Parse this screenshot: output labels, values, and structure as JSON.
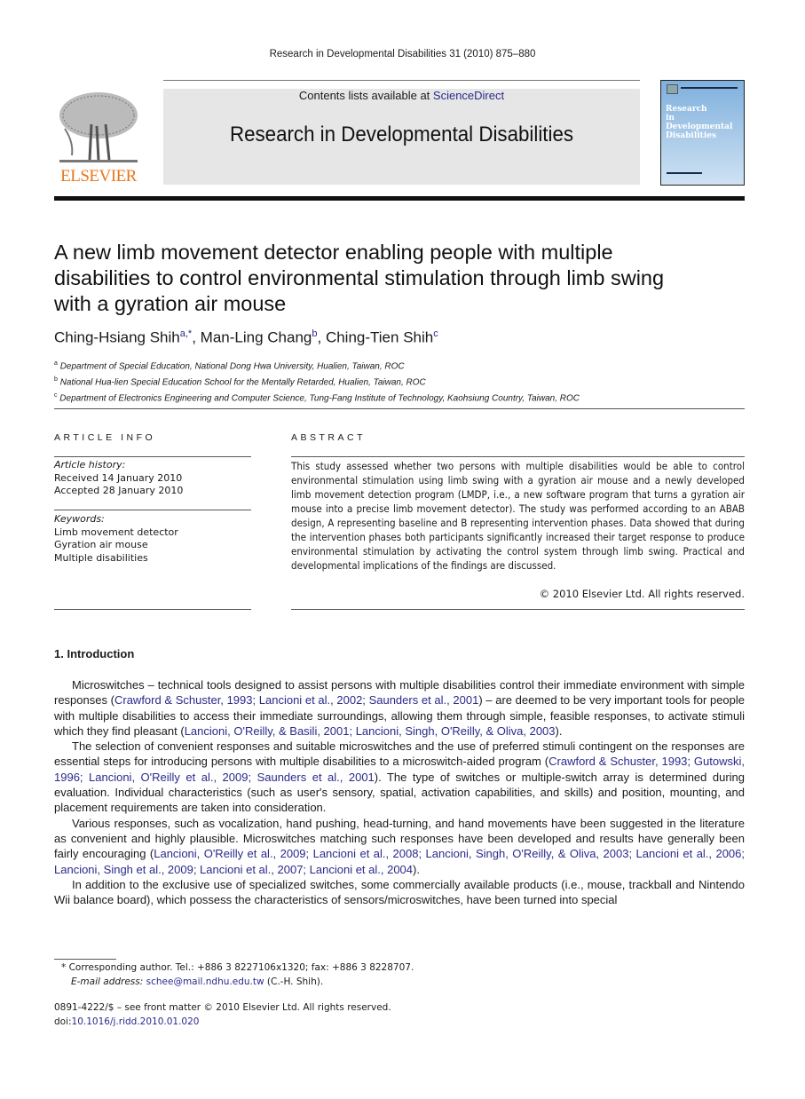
{
  "header": {
    "journal_reference": "Research in Developmental Disabilities 31 (2010) 875–880",
    "contents_prefix": "Contents lists available at ",
    "contents_link": "ScienceDirect",
    "journal_title": "Research in Developmental Disabilities",
    "publisher_logo_text": "ELSEVIER",
    "cover_title_lines": [
      "Research",
      "in",
      "Developmental",
      "Disabilities"
    ]
  },
  "colors": {
    "link": "#2a2a8c",
    "elsevier_orange": "#e7761c",
    "banner_bg": "#e6e6e6"
  },
  "article": {
    "title": "A new limb movement detector enabling people with multiple disabilities to control environmental stimulation through limb swing with a gyration air mouse",
    "authors": [
      {
        "name": "Ching-Hsiang Shih",
        "marks": "a,*"
      },
      {
        "name": "Man-Ling Chang",
        "marks": "b"
      },
      {
        "name": "Ching-Tien Shih",
        "marks": "c"
      }
    ],
    "affiliations": [
      {
        "mark": "a",
        "text": "Department of Special Education, National Dong Hwa University, Hualien, Taiwan, ROC"
      },
      {
        "mark": "b",
        "text": "National Hua-lien Special Education School for the Mentally Retarded, Hualien, Taiwan, ROC"
      },
      {
        "mark": "c",
        "text": "Department of Electronics Engineering and Computer Science, Tung-Fang Institute of Technology, Kaohsiung Country, Taiwan, ROC"
      }
    ]
  },
  "article_info": {
    "heading": "ARTICLE INFO",
    "history_label": "Article history:",
    "received": "Received 14 January 2010",
    "accepted": "Accepted 28 January 2010",
    "keywords_label": "Keywords:",
    "keywords": [
      "Limb movement detector",
      "Gyration air mouse",
      "Multiple disabilities"
    ]
  },
  "abstract": {
    "heading": "ABSTRACT",
    "text": "This study assessed whether two persons with multiple disabilities would be able to control environmental stimulation using limb swing with a gyration air mouse and a newly developed limb movement detection program (LMDP, i.e., a new software program that turns a gyration air mouse into a precise limb movement detector). The study was performed according to an ABAB design, A representing baseline and B representing intervention phases. Data showed that during the intervention phases both participants significantly increased their target response to produce environmental stimulation by activating the control system through limb swing. Practical and developmental implications of the findings are discussed.",
    "copyright": "© 2010 Elsevier Ltd. All rights reserved."
  },
  "introduction": {
    "heading": "1.  Introduction",
    "paragraphs": [
      [
        {
          "t": "Microswitches – technical tools designed to assist persons with multiple disabilities control their immediate environment with simple responses ("
        },
        {
          "t": "Crawford & Schuster, 1993; Lancioni et al., 2002; Saunders et al., 2001",
          "link": true
        },
        {
          "t": ") – are deemed to be very important tools for people with multiple disabilities to access their immediate surroundings, allowing them through simple, feasible responses, to activate stimuli which they find pleasant ("
        },
        {
          "t": "Lancioni, O'Reilly, & Basili, 2001; Lancioni, Singh, O'Reilly, & Oliva, 2003",
          "link": true
        },
        {
          "t": ")."
        }
      ],
      [
        {
          "t": "The selection of convenient responses and suitable microswitches and the use of preferred stimuli contingent on the responses are essential steps for introducing persons with multiple disabilities to a microswitch-aided program ("
        },
        {
          "t": "Crawford & Schuster, 1993; Gutowski, 1996; Lancioni, O'Reilly et al., 2009; Saunders et al., 2001",
          "link": true
        },
        {
          "t": "). The type of switches or multiple-switch array is determined during evaluation. Individual characteristics (such as user's sensory, spatial, activation capabilities, and skills) and position, mounting, and placement requirements are taken into consideration."
        }
      ],
      [
        {
          "t": "Various responses, such as vocalization, hand pushing, head-turning, and hand movements have been suggested in the literature as convenient and highly plausible. Microswitches matching such responses have been developed and results have generally been fairly encouraging ("
        },
        {
          "t": "Lancioni, O'Reilly et al., 2009; Lancioni et al., 2008; Lancioni, Singh, O'Reilly, & Oliva, 2003; Lancioni et al., 2006; Lancioni, Singh et al., 2009; Lancioni et al., 2007; Lancioni et al., 2004",
          "link": true
        },
        {
          "t": ")."
        }
      ],
      [
        {
          "t": "In addition to the exclusive use of specialized switches, some commercially available products (i.e., mouse, trackball and Nintendo Wii balance board), which possess the characteristics of sensors/microswitches, have been turned into special"
        }
      ]
    ]
  },
  "footnotes": {
    "corresponding": "*  Corresponding author. Tel.: +886 3 8227106x1320; fax: +886 3 8228707.",
    "email_label": "E-mail address: ",
    "email": "schee@mail.ndhu.edu.tw",
    "email_suffix": " (C.-H. Shih).",
    "issn_line": "0891-4222/$ – see front matter © 2010 Elsevier Ltd. All rights reserved.",
    "doi_prefix": "doi:",
    "doi": "10.1016/j.ridd.2010.01.020"
  }
}
